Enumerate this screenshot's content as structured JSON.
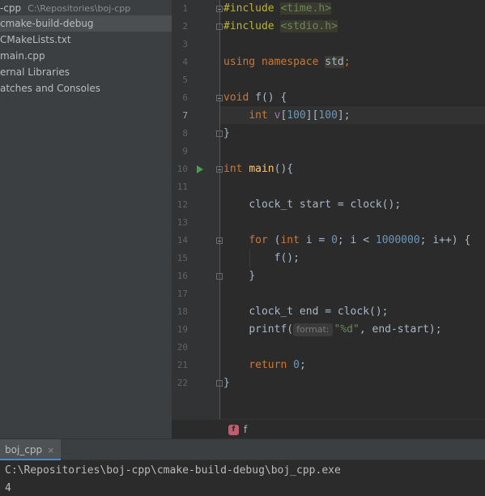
{
  "project_tree": {
    "items": [
      {
        "label": "-cpp",
        "hint": "C:\\Repositories\\boj-cpp"
      },
      {
        "label": "cmake-build-debug"
      },
      {
        "label": "CMakeLists.txt"
      },
      {
        "label": "main.cpp"
      },
      {
        "label": "ernal Libraries"
      },
      {
        "label": "atches and Consoles"
      }
    ]
  },
  "editor": {
    "current_line": 7,
    "line_numbers": [
      "1",
      "2",
      "3",
      "4",
      "5",
      "6",
      "7",
      "8",
      "9",
      "10",
      "11",
      "12",
      "13",
      "14",
      "15",
      "16",
      "17",
      "18",
      "19",
      "20",
      "21",
      "22"
    ],
    "inlay_hint": "format:",
    "tokens": {
      "include": "#include",
      "time_h": "<time.h>",
      "stdio_h": "<stdio.h>",
      "using": "using",
      "namespace": "namespace",
      "std": "std",
      "void": "void",
      "f_sig": " f() {",
      "int": "int",
      "v": " v",
      "lb1": "[",
      "n100a": "100",
      "rb1": "][",
      "n100b": "100",
      "rb2": "];",
      "close_brace": "}",
      "main_sig": " main(){",
      "main": "main",
      "clock_start": "clock_t start = clock();",
      "for": "for",
      "for_open": " (",
      "int_i": "int",
      "i_eq": " i = ",
      "zero": "0",
      "cond": "; i < ",
      "million": "1000000",
      "incr": "; i++) {",
      "call_f": "f();",
      "clock_end": "clock_t end = clock();",
      "printf_open": "printf(",
      "fmt": "\"%d\"",
      "printf_rest": ", end-start);",
      "return": "return",
      "ret_zero": "0",
      "semicolon": ";"
    }
  },
  "breadcrumb": {
    "badge": "f",
    "label": "f"
  },
  "run_panel": {
    "tab_label": "boj_cpp",
    "close_glyph": "×",
    "output": [
      "C:\\Repositories\\boj-cpp\\cmake-build-debug\\boj_cpp.exe",
      "4"
    ]
  },
  "colors": {
    "keyword": "#cc7832",
    "number": "#6897bb",
    "string": "#6a8759",
    "function": "#ffc66d",
    "run_icon": "#499c54",
    "background": "#2b2b2b"
  }
}
